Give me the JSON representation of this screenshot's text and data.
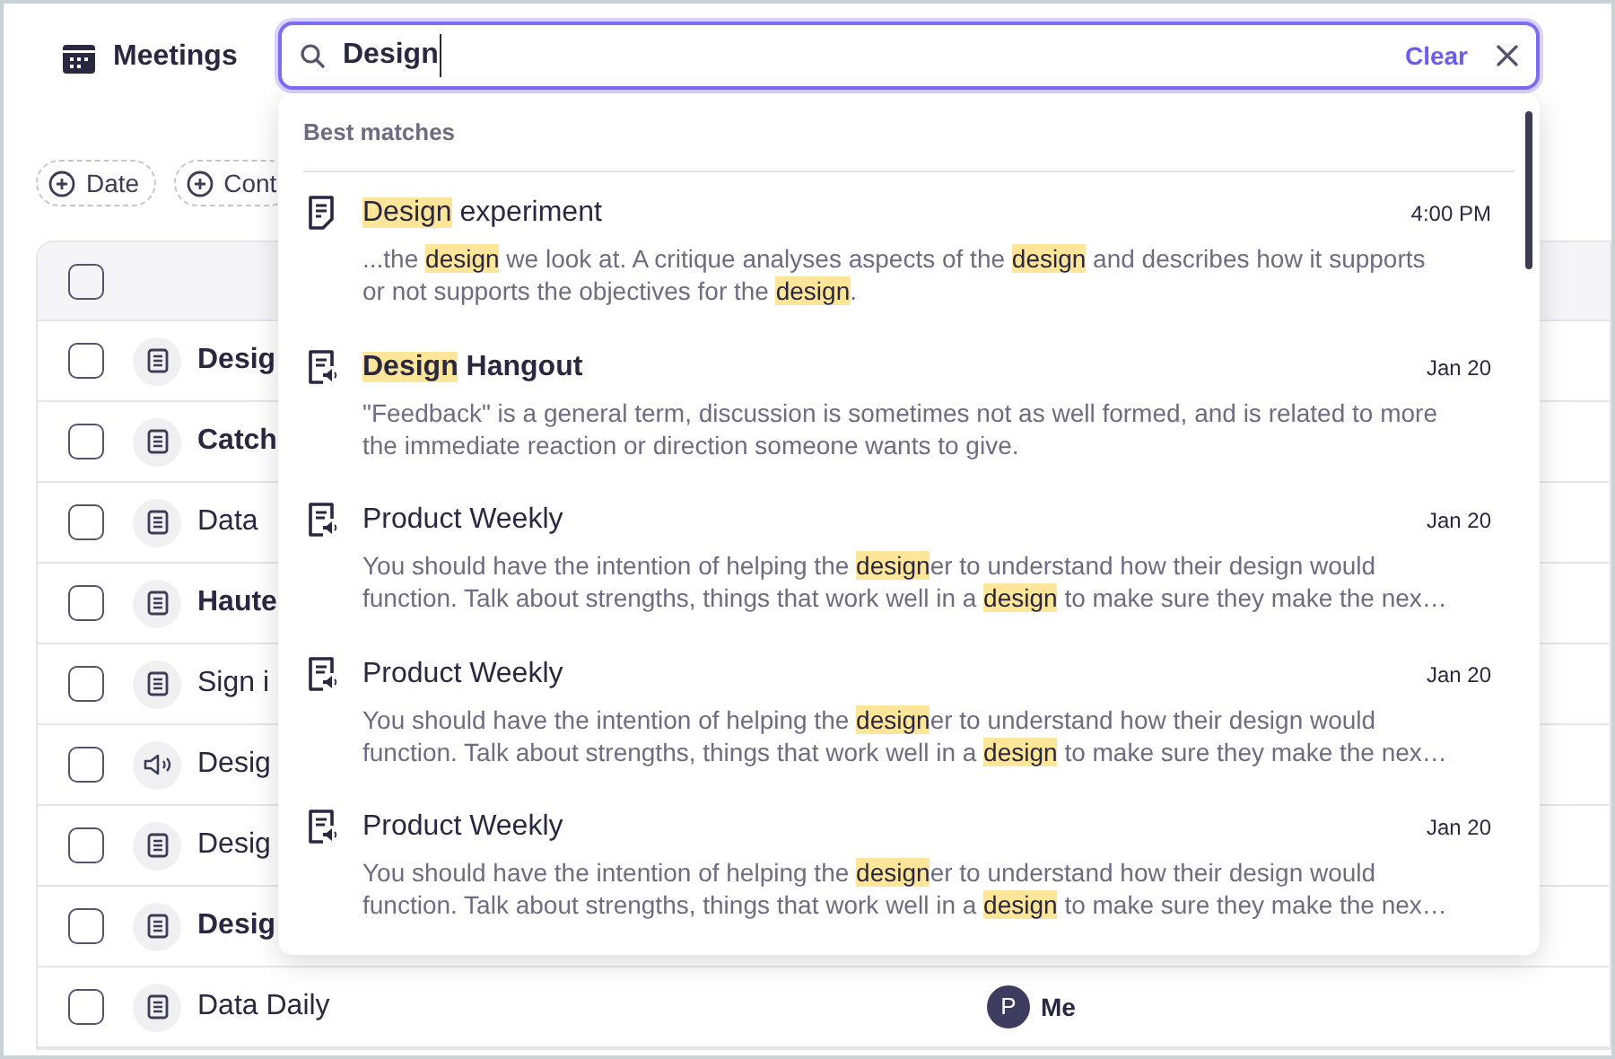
{
  "header": {
    "title": "Meetings"
  },
  "search": {
    "value": "Design",
    "clear_label": "Clear"
  },
  "filters": [
    {
      "label": "Date"
    },
    {
      "label": "Cont"
    }
  ],
  "table": {
    "header_checked": false,
    "rows": [
      {
        "kind": "doc",
        "name": "Desig",
        "unread": true,
        "checked": false
      },
      {
        "kind": "doc",
        "name": "Catch",
        "unread": true,
        "checked": false
      },
      {
        "kind": "doc",
        "name": "Data",
        "unread": false,
        "checked": false
      },
      {
        "kind": "doc",
        "name": "Haute",
        "unread": true,
        "checked": false
      },
      {
        "kind": "doc",
        "name": "Sign i",
        "unread": false,
        "checked": false
      },
      {
        "kind": "audio",
        "name": "Desig",
        "unread": false,
        "checked": false
      },
      {
        "kind": "doc",
        "name": "Desig",
        "unread": false,
        "checked": false
      },
      {
        "kind": "doc",
        "name": "Desig",
        "unread": true,
        "checked": false
      },
      {
        "kind": "doc",
        "name": "Data Daily",
        "unread": false,
        "checked": false,
        "owner": {
          "initial": "P",
          "name": "Me"
        }
      }
    ]
  },
  "results": {
    "heading": "Best matches",
    "items": [
      {
        "kind": "notes",
        "unread": false,
        "time": "4:00 PM",
        "title": [
          {
            "text": "Design",
            "highlight": true
          },
          {
            "text": " experiment",
            "highlight": false
          }
        ],
        "lines": [
          [
            {
              "text": "...the ",
              "highlight": false
            },
            {
              "text": "design",
              "highlight": true
            },
            {
              "text": " we look at. A critique analyses aspects of the ",
              "highlight": false
            },
            {
              "text": "design",
              "highlight": true
            },
            {
              "text": " and describes how it supports",
              "highlight": false
            }
          ],
          [
            {
              "text": "or not supports the objectives for the ",
              "highlight": false
            },
            {
              "text": "design",
              "highlight": true
            },
            {
              "text": ".",
              "highlight": false
            }
          ]
        ]
      },
      {
        "kind": "notes_audio",
        "unread": true,
        "time": "Jan 20",
        "title": [
          {
            "text": "Design",
            "highlight": true
          },
          {
            "text": " Hangout",
            "highlight": false
          }
        ],
        "lines": [
          [
            {
              "text": "\"Feedback\" is a general term, discussion  is sometimes not as well formed, and is related to more",
              "highlight": false
            }
          ],
          [
            {
              "text": "the immediate reaction or direction someone wants to give.",
              "highlight": false
            }
          ]
        ]
      },
      {
        "kind": "notes_audio",
        "unread": false,
        "time": "Jan 20",
        "title": [
          {
            "text": "Product Weekly",
            "highlight": false
          }
        ],
        "lines": [
          [
            {
              "text": "You should have the intention of helping the ",
              "highlight": false
            },
            {
              "text": "design",
              "highlight": true
            },
            {
              "text": "er to understand how their design would",
              "highlight": false
            }
          ],
          [
            {
              "text": "function. Talk about strengths, things that work well in a ",
              "highlight": false
            },
            {
              "text": "design",
              "highlight": true
            },
            {
              "text": " to make sure they make the nex…",
              "highlight": false
            }
          ]
        ]
      },
      {
        "kind": "notes_audio",
        "unread": false,
        "time": "Jan 20",
        "title": [
          {
            "text": "Product Weekly",
            "highlight": false
          }
        ],
        "lines": [
          [
            {
              "text": "You should have the intention of helping the ",
              "highlight": false
            },
            {
              "text": "design",
              "highlight": true
            },
            {
              "text": "er to understand how their design would",
              "highlight": false
            }
          ],
          [
            {
              "text": "function. Talk about strengths, things that work well in a ",
              "highlight": false
            },
            {
              "text": "design",
              "highlight": true
            },
            {
              "text": " to make sure they make the nex…",
              "highlight": false
            }
          ]
        ]
      },
      {
        "kind": "notes_audio",
        "unread": false,
        "time": "Jan 20",
        "title": [
          {
            "text": "Product Weekly",
            "highlight": false
          }
        ],
        "lines": [
          [
            {
              "text": "You should have the intention of helping the ",
              "highlight": false
            },
            {
              "text": "design",
              "highlight": true
            },
            {
              "text": "er to understand how their design would",
              "highlight": false
            }
          ],
          [
            {
              "text": "function. Talk about strengths, things that work well in a ",
              "highlight": false
            },
            {
              "text": "design",
              "highlight": true
            },
            {
              "text": " to make sure they make the nex…",
              "highlight": false
            }
          ]
        ]
      }
    ]
  }
}
